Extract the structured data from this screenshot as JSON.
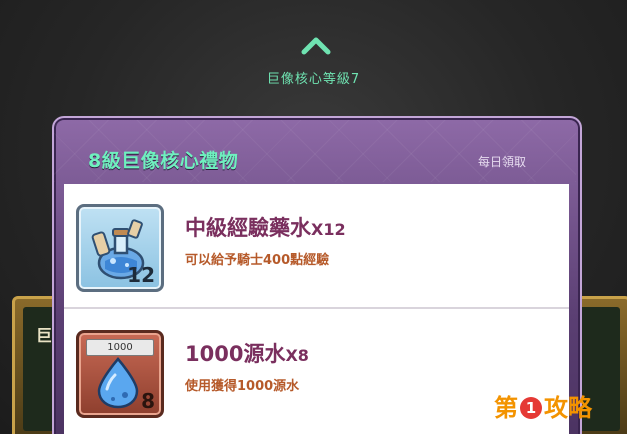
{
  "top": {
    "chevron_icon": "chevron-up-icon",
    "level_label": "巨像核心等級7"
  },
  "side_left": {
    "label": "巨"
  },
  "panel": {
    "title": "8級巨像核心禮物",
    "subtitle": "每日領取",
    "items": [
      {
        "icon": "potion-bottles-icon",
        "icon_count": "12",
        "name": "中級經驗藥水",
        "qty": "X12",
        "desc": "可以給予騎士400點經驗"
      },
      {
        "icon": "water-drop-icon",
        "cap": "1000",
        "icon_count": "8",
        "name": "1000源水",
        "qty": "X8",
        "desc": "使用獲得1000源水"
      }
    ]
  },
  "watermark": {
    "left": "第",
    "num": "1",
    "right": "攻略"
  },
  "colors": {
    "accent_green": "#6ff0bf",
    "panel_purple": "#8e6aa7",
    "item_name": "#7a2f5e",
    "item_desc": "#b65a2a",
    "watermark_orange": "#f39300"
  }
}
